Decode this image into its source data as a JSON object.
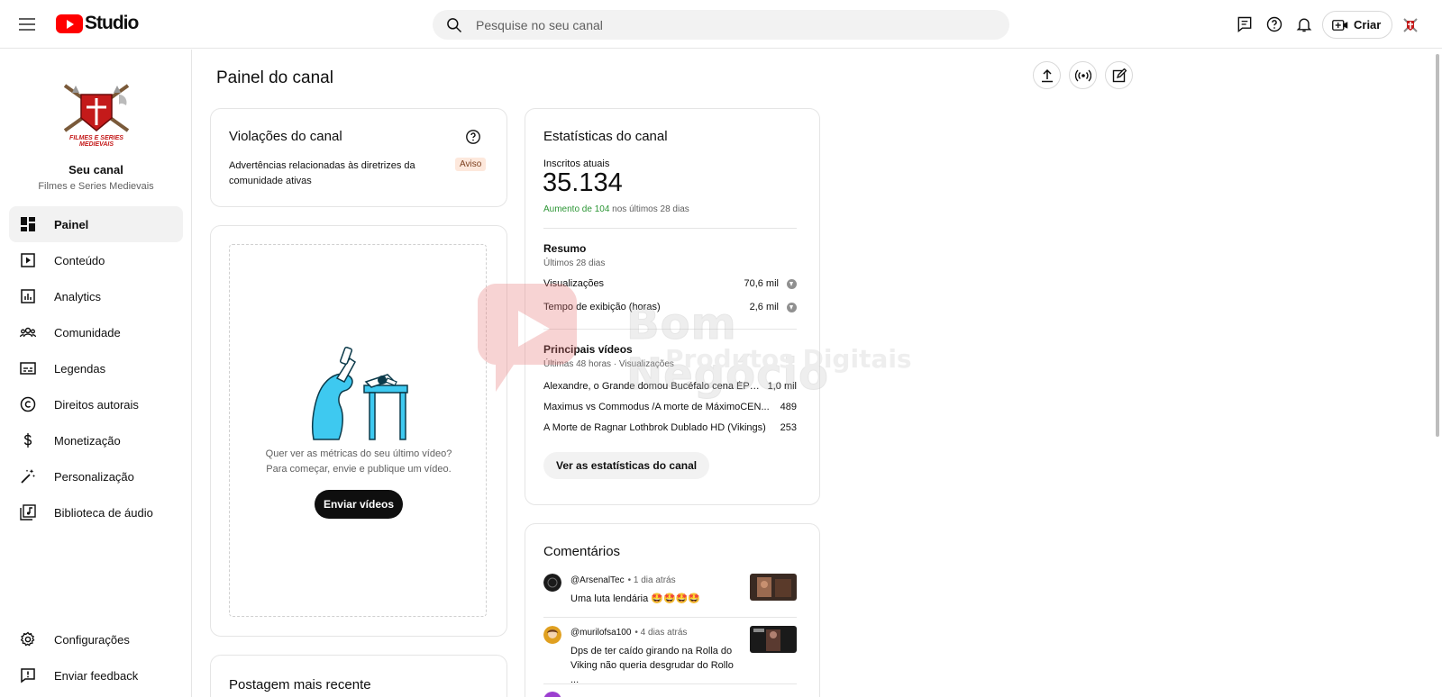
{
  "header": {
    "logo_text": "Studio",
    "search_placeholder": "Pesquise no seu canal",
    "create_label": "Criar"
  },
  "sidebar": {
    "channel_title": "Seu canal",
    "channel_name": "Filmes e Series Medievais",
    "items": [
      {
        "label": "Painel",
        "icon": "dashboard-icon",
        "active": true
      },
      {
        "label": "Conteúdo",
        "icon": "content-icon"
      },
      {
        "label": "Analytics",
        "icon": "analytics-icon"
      },
      {
        "label": "Comunidade",
        "icon": "community-icon"
      },
      {
        "label": "Legendas",
        "icon": "subtitles-icon"
      },
      {
        "label": "Direitos autorais",
        "icon": "copyright-icon"
      },
      {
        "label": "Monetização",
        "icon": "monetization-icon"
      },
      {
        "label": "Personalização",
        "icon": "customization-icon"
      },
      {
        "label": "Biblioteca de áudio",
        "icon": "audio-library-icon"
      }
    ],
    "bottom_items": [
      {
        "label": "Configurações",
        "icon": "settings-icon"
      },
      {
        "label": "Enviar feedback",
        "icon": "feedback-icon"
      }
    ]
  },
  "page": {
    "title": "Painel do canal"
  },
  "violations": {
    "title": "Violações do canal",
    "text": "Advertências relacionadas às diretrizes da comunidade ativas",
    "badge": "Aviso"
  },
  "upload": {
    "line1": "Quer ver as métricas do seu último vídeo?",
    "line2": "Para começar, envie e publique um vídeo.",
    "button": "Enviar vídeos"
  },
  "latest_post": {
    "title": "Postagem mais recente"
  },
  "stats": {
    "title": "Estatísticas do canal",
    "subscribers_label": "Inscritos atuais",
    "subscribers": "35.134",
    "increase_highlight": "Aumento de 104",
    "increase_rest": "nos últimos 28 dias",
    "summary_title": "Resumo",
    "summary_period": "Últimos 28 dias",
    "summary": [
      {
        "label": "Visualizações",
        "value": "70,6 mil"
      },
      {
        "label": "Tempo de exibição (horas)",
        "value": "2,6 mil"
      }
    ],
    "top_videos_title": "Principais vídeos",
    "top_videos_period": "Últimas 48 horas · Visualizações",
    "top_videos": [
      {
        "title": "Alexandre, o Grande domou Bucéfalo cena ÉPICA ...",
        "views": "1,0 mil"
      },
      {
        "title": "Maximus vs Commodus /A morte de MáximoCEN...",
        "views": "489"
      },
      {
        "title": "A Morte de Ragnar Lothbrok Dublado HD (Vikings)",
        "views": "253"
      }
    ],
    "button": "Ver as estatísticas do canal"
  },
  "comments": {
    "title": "Comentários",
    "items": [
      {
        "author": "@ArsenalTec",
        "time": "• 1 dia atrás",
        "text": "Uma luta lendária 🤩🤩🤩🤩"
      },
      {
        "author": "@murilofsa100",
        "time": "• 4 dias atrás",
        "text": "Dps de ter caído girando na Rolla do Viking não queria desgrudar do Rollo ..."
      }
    ]
  },
  "watermark": {
    "line1": "Bom Negócio",
    "line2": "Produtos Digitais"
  },
  "colors": {
    "brand_red": "#ff0000",
    "increase_green": "#2b9534",
    "warning_badge": "#fde8dc",
    "illustration_cyan": "#3ec9f0"
  }
}
